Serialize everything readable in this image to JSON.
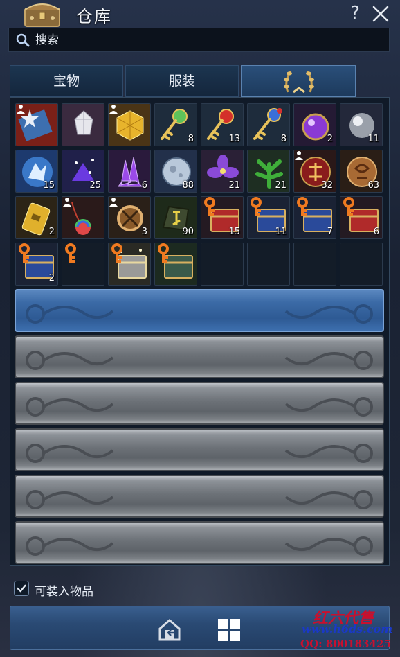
{
  "window": {
    "title": "仓库",
    "help_label": "?",
    "close_icon": "close-icon"
  },
  "search": {
    "placeholder": "搜索",
    "value": ""
  },
  "tabs": [
    {
      "label": "宝物",
      "active": false
    },
    {
      "label": "服装",
      "active": false
    },
    {
      "label": "",
      "icon": "laurel-icon",
      "active": true
    }
  ],
  "items": [
    {
      "icon": "star-ticket-icon",
      "count": "",
      "bound": true
    },
    {
      "icon": "white-star-gem-icon",
      "count": "",
      "bound": false
    },
    {
      "icon": "gold-cube-icon",
      "count": "",
      "bound": true
    },
    {
      "icon": "green-key-icon",
      "count": "8",
      "bound": false
    },
    {
      "icon": "red-key-icon",
      "count": "13",
      "bound": false
    },
    {
      "icon": "blue-key-icon",
      "count": "8",
      "bound": false
    },
    {
      "icon": "purple-orb-icon",
      "count": "2",
      "bound": false
    },
    {
      "icon": "silver-orb-icon",
      "count": "11",
      "bound": false
    },
    {
      "icon": "ice-crystal-icon",
      "count": "15",
      "bound": false
    },
    {
      "icon": "sparkle-crystal-icon",
      "count": "25",
      "bound": false
    },
    {
      "icon": "amethyst-icon",
      "count": "6",
      "bound": false
    },
    {
      "icon": "moon-orb-icon",
      "count": "88",
      "bound": false
    },
    {
      "icon": "violet-flower-icon",
      "count": "21",
      "bound": false
    },
    {
      "icon": "green-herb-icon",
      "count": "21",
      "bound": false
    },
    {
      "icon": "red-seal-icon",
      "count": "32",
      "bound": true
    },
    {
      "icon": "bronze-seal-icon",
      "count": "63",
      "bound": false
    },
    {
      "icon": "gold-tablet-icon",
      "count": "2",
      "bound": false
    },
    {
      "icon": "rainbow-pendant-icon",
      "count": "",
      "bound": true
    },
    {
      "icon": "bronze-relic-icon",
      "count": "3",
      "bound": true
    },
    {
      "icon": "rune-stone-icon",
      "count": "90",
      "bound": false
    },
    {
      "icon": "red-chest-icon",
      "count": "15",
      "bound": false
    },
    {
      "icon": "blue-chest-icon",
      "count": "11",
      "bound": false
    },
    {
      "icon": "blue-chest-icon",
      "count": "7",
      "bound": false
    },
    {
      "icon": "red-chest-icon",
      "count": "6",
      "bound": false
    },
    {
      "icon": "blue-chest-icon",
      "count": "2",
      "bound": false
    },
    {
      "icon": "key-only-icon",
      "count": "",
      "bound": false
    },
    {
      "icon": "silver-chest-icon",
      "count": "",
      "bound": false
    },
    {
      "icon": "green-chest-icon",
      "count": "",
      "bound": false
    },
    {
      "icon": "empty",
      "count": ""
    },
    {
      "icon": "empty",
      "count": ""
    },
    {
      "icon": "empty",
      "count": ""
    },
    {
      "icon": "empty",
      "count": ""
    }
  ],
  "bank_bars": [
    "unlocked",
    "locked",
    "locked",
    "locked",
    "locked",
    "locked"
  ],
  "checkbox": {
    "label": "可装入物品",
    "checked": true
  },
  "bottom": {
    "deposit_icon": "deposit-icon",
    "sort_icon": "grid-icon"
  },
  "watermark": {
    "line1": "红六代售",
    "line2": "www.h6ds.com",
    "line3": "QQ: 800183425"
  },
  "colors": {
    "accent": "#3b6aa6",
    "panel": "#101a28",
    "count_text": "#ffffff"
  }
}
